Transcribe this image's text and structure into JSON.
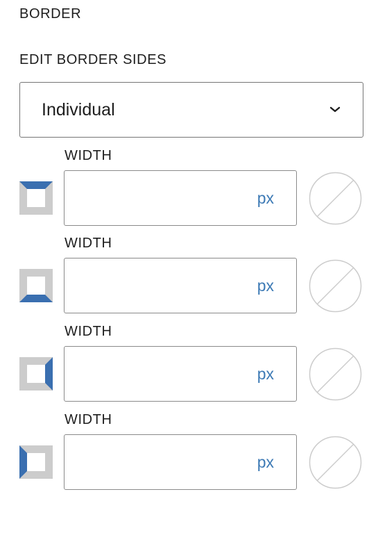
{
  "panel": {
    "border_heading": "BORDER",
    "edit_sides_heading": "EDIT BORDER SIDES"
  },
  "sides_select": {
    "value": "Individual",
    "icon": "chevron-down-icon"
  },
  "sides": [
    {
      "side": "top",
      "label": "WIDTH",
      "value": "",
      "unit": "px",
      "icon": "border-top-icon",
      "color": "none"
    },
    {
      "side": "bottom",
      "label": "WIDTH",
      "value": "",
      "unit": "px",
      "icon": "border-bottom-icon",
      "color": "none"
    },
    {
      "side": "right",
      "label": "WIDTH",
      "value": "",
      "unit": "px",
      "icon": "border-right-icon",
      "color": "none"
    },
    {
      "side": "left",
      "label": "WIDTH",
      "value": "",
      "unit": "px",
      "icon": "border-left-icon",
      "color": "none"
    }
  ],
  "colors": {
    "accent": "#3a6fb0",
    "icon_gray": "#cccccc",
    "unit_text": "#3d7ab5",
    "input_border": "#8a8a8a",
    "swatch_stroke": "#cccccc"
  }
}
